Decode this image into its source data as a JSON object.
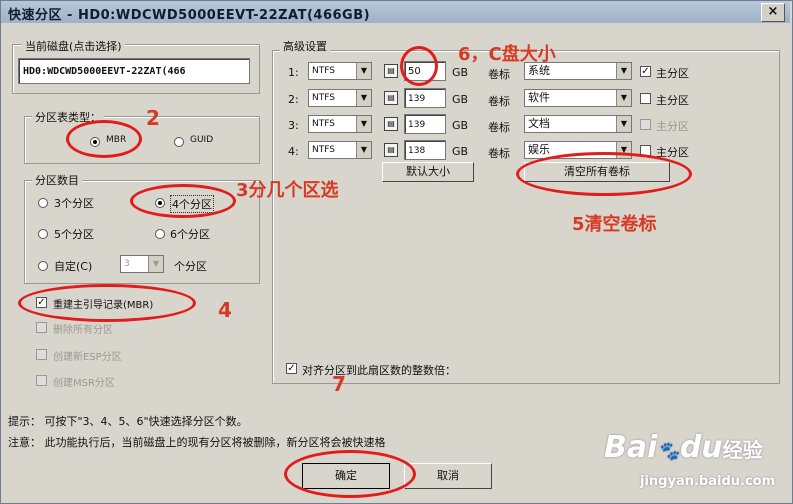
{
  "window": {
    "title": "快速分区 - HD0:WDCWD5000EEVT-22ZAT(466GB)",
    "close": "×"
  },
  "current_disk": {
    "label": "当前磁盘(点击选择)",
    "value": "HD0:WDCWD5000EEVT-22ZAT(466"
  },
  "partition_table": {
    "label": "分区表类型：",
    "options": [
      "MBR",
      "GUID"
    ],
    "selected": "MBR"
  },
  "partition_count": {
    "label": "分区数目",
    "options": [
      "3个分区",
      "4个分区",
      "5个分区",
      "6个分区"
    ],
    "selected": "4个分区",
    "custom_label": "自定(C)",
    "custom_value": "3",
    "custom_suffix": "个分区"
  },
  "checks": {
    "rebuild_mbr": "重建主引导记录(MBR)",
    "opt2": "删除所有分区",
    "opt3": "创建新ESP分区",
    "opt4": "创建MSR分区"
  },
  "advanced": {
    "label": "高级设置",
    "rows": [
      {
        "num": "1:",
        "fs": "NTFS",
        "size": "50",
        "unit": "GB",
        "vol_label": "卷标",
        "vol": "系统",
        "primary": "主分区",
        "primary_checked": true
      },
      {
        "num": "2:",
        "fs": "NTFS",
        "size": "139",
        "unit": "GB",
        "vol_label": "卷标",
        "vol": "软件",
        "primary": "主分区",
        "primary_checked": false
      },
      {
        "num": "3:",
        "fs": "NTFS",
        "size": "139",
        "unit": "GB",
        "vol_label": "卷标",
        "vol": "文档",
        "primary": "主分区",
        "primary_checked": false
      },
      {
        "num": "4:",
        "fs": "NTFS",
        "size": "138",
        "unit": "GB",
        "vol_label": "卷标",
        "vol": "娱乐",
        "primary": "主分区",
        "primary_checked": false
      }
    ],
    "default_size_button": "默认大小",
    "clear_labels_button": "清空所有卷标",
    "align_label": "对齐分区到此扇区数的整数倍："
  },
  "tips": {
    "line1": "提示： 可按下\"3、4、5、6\"快速选择分区个数。",
    "line2": "注意： 此功能执行后，当前磁盘上的现有分区将被删除，新分区将会被快速格"
  },
  "buttons": {
    "ok": "确定",
    "cancel": "取消"
  },
  "annotations": {
    "n2": "2",
    "n3": "3分几个区选",
    "n4": "4",
    "n5": "5清空卷标",
    "n6": "6，C盘大小",
    "n7": "7"
  },
  "watermark": {
    "brand": "Bai",
    "brand2": "经验",
    "paw": "du",
    "url": "jingyan.baidu.com"
  },
  "colors": {
    "annotation": "#e21b1b",
    "title_bar": "#a9bad0"
  }
}
